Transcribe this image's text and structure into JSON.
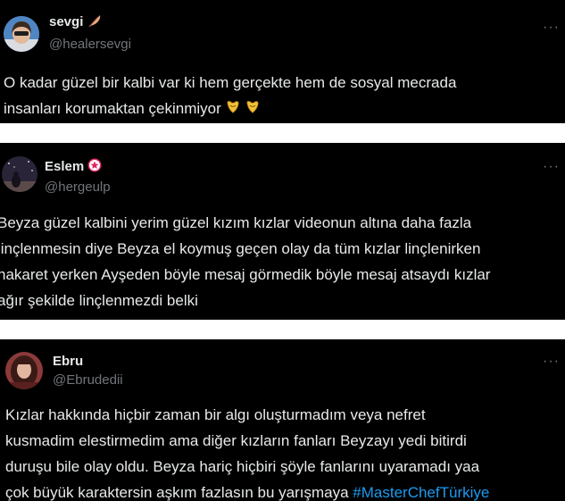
{
  "tweets": [
    {
      "name": "sevgi",
      "name_emoji": "feather-icon",
      "handle": "@healersevgi",
      "more": "···",
      "lines": [
        "O kadar güzel bir kalbi var ki hem gerçekte hem de sosyal mecrada",
        "insanları korumaktan çekinmiyor"
      ],
      "trailing_emoji": "heart-hands-icon"
    },
    {
      "name": "Eslem",
      "name_emoji": "badge-icon",
      "handle": "@hergeulp",
      "more": "···",
      "lines": [
        "Beyza güzel kalbini yerim güzel kızım kızlar videonun altına daha fazla",
        "linçlenmesin diye Beyza el koymuş geçen olay da tüm kızlar linçlenirken",
        "hakaret yerken Ayşeden böyle mesaj görmedik böyle mesaj atsaydı kızlar",
        "ağır şekilde linçlenmezdi belki"
      ]
    },
    {
      "name": "Ebru",
      "handle": "@Ebrudedii",
      "more": "···",
      "lines": [
        "Kızlar  hakkında hiçbir zaman bir algı oluşturmadım veya nefret",
        "kusmadim elestirmedim ama diğer kızların  fanları Beyzayı yedi bitirdi",
        "duruşu bile olay oldu. Beyza hariç hiçbiri şöyle fanlarını uyaramadı yaa",
        "çok büyük karaktersin aşkım fazlasın bu yarışmaya"
      ],
      "hashtag": "#MasterChefTürkiye"
    }
  ],
  "colors": {
    "background": "#000000",
    "text": "#e7e9ea",
    "secondary": "#71767b",
    "link": "#1d9bf0"
  }
}
